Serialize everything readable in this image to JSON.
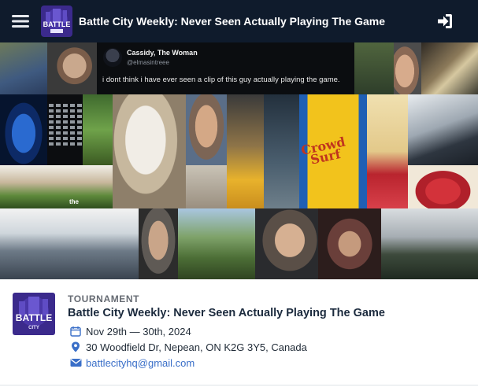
{
  "header": {
    "title": "Battle City Weekly: Never Seen Actually Playing The Game",
    "logo_text_top": "BATTLE",
    "logo_text_bottom": "CITY",
    "menu_icon": "hamburger-icon",
    "login_icon": "sign-in-icon"
  },
  "banner": {
    "tweet": {
      "name": "Cassidy, The Woman",
      "handle": "@elmasintreee",
      "text": "i dont think i have ever seen a clip of this guy actually playing the game."
    },
    "caption": "the",
    "can_text": "Crowd Surf"
  },
  "event": {
    "category": "TOURNAMENT",
    "title": "Battle City Weekly: Never Seen Actually Playing The Game",
    "date": "Nov 29th — 30th, 2024",
    "address": "30 Woodfield Dr, Nepean, ON K2G 3Y5, Canada",
    "email": "battlecityhq@gmail.com",
    "logo_text_top": "BATTLE",
    "logo_text_bottom": "CITY"
  },
  "colors": {
    "header_bg": "#0f1b2c",
    "logo_bg": "#3b2a8c",
    "accent_blue": "#3a6fc8",
    "title": "#1b2a3d"
  }
}
